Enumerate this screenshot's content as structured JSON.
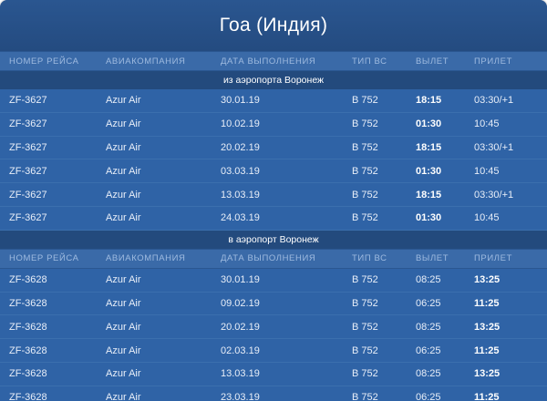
{
  "title": "Гоа (Индия)",
  "columns": [
    "НОМЕР РЕЙСА",
    "АВИАКОМПАНИЯ",
    "ДАТА ВЫПОЛНЕНИЯ",
    "ТИП ВС",
    "ВЫЛЕТ",
    "ПРИЛЕТ"
  ],
  "sections": [
    {
      "label": "из аэропорта Воронеж",
      "rows": [
        {
          "flight": "ZF-3627",
          "airline": "Azur Air",
          "date": "30.01.19",
          "type": "B 752",
          "dep": "18:15",
          "arr": "03:30/+1"
        },
        {
          "flight": "ZF-3627",
          "airline": "Azur Air",
          "date": "10.02.19",
          "type": "B 752",
          "dep": "01:30",
          "arr": "10:45"
        },
        {
          "flight": "ZF-3627",
          "airline": "Azur Air",
          "date": "20.02.19",
          "type": "B 752",
          "dep": "18:15",
          "arr": "03:30/+1"
        },
        {
          "flight": "ZF-3627",
          "airline": "Azur Air",
          "date": "03.03.19",
          "type": "B 752",
          "dep": "01:30",
          "arr": "10:45"
        },
        {
          "flight": "ZF-3627",
          "airline": "Azur Air",
          "date": "13.03.19",
          "type": "B 752",
          "dep": "18:15",
          "arr": "03:30/+1"
        },
        {
          "flight": "ZF-3627",
          "airline": "Azur Air",
          "date": "24.03.19",
          "type": "B 752",
          "dep": "01:30",
          "arr": "10:45"
        }
      ]
    },
    {
      "label": "в аэропорт Воронеж",
      "rows": [
        {
          "flight": "ZF-3628",
          "airline": "Azur Air",
          "date": "30.01.19",
          "type": "B 752",
          "dep": "08:25",
          "arr": "13:25"
        },
        {
          "flight": "ZF-3628",
          "airline": "Azur Air",
          "date": "09.02.19",
          "type": "B 752",
          "dep": "06:25",
          "arr": "11:25"
        },
        {
          "flight": "ZF-3628",
          "airline": "Azur Air",
          "date": "20.02.19",
          "type": "B 752",
          "dep": "08:25",
          "arr": "13:25"
        },
        {
          "flight": "ZF-3628",
          "airline": "Azur Air",
          "date": "02.03.19",
          "type": "B 752",
          "dep": "06:25",
          "arr": "11:25"
        },
        {
          "flight": "ZF-3628",
          "airline": "Azur Air",
          "date": "13.03.19",
          "type": "B 752",
          "dep": "08:25",
          "arr": "13:25"
        },
        {
          "flight": "ZF-3628",
          "airline": "Azur Air",
          "date": "23.03.19",
          "type": "B 752",
          "dep": "06:25",
          "arr": "11:25"
        }
      ]
    }
  ]
}
